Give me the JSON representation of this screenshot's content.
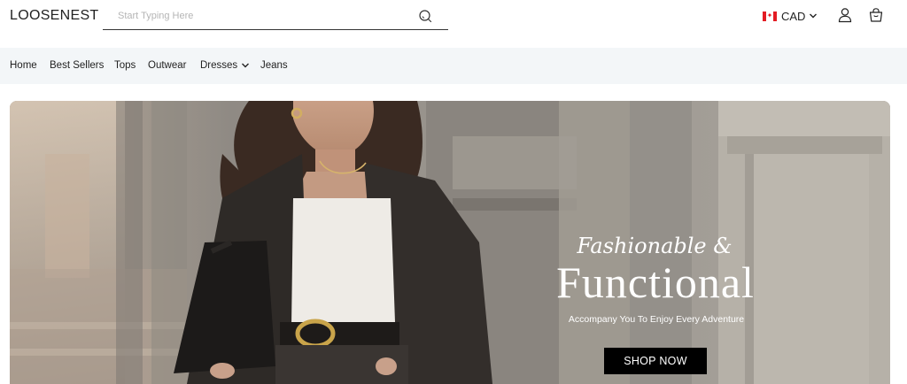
{
  "header": {
    "logo": "LOOSENEST",
    "search": {
      "placeholder": "Start Typing Here",
      "value": ""
    },
    "currency": {
      "code": "CAD",
      "flag": "canada-flag"
    },
    "icons": [
      "search-icon",
      "chevron-down-icon",
      "user-icon",
      "shopping-bag-icon"
    ]
  },
  "nav": {
    "items": [
      {
        "label": "Home"
      },
      {
        "label": "Best Sellers"
      },
      {
        "label": "Tops"
      },
      {
        "label": "Outwear"
      },
      {
        "label": "Dresses",
        "has_dropdown": true
      },
      {
        "label": "Jeans"
      }
    ]
  },
  "hero": {
    "kicker": "Fashionable &",
    "title": "Functional",
    "subtitle": "Accompany You To Enjoy Every Adventure",
    "cta": "SHOP NOW"
  },
  "colors": {
    "nav_bg": "#f3f6f8",
    "cta_bg": "#000000",
    "flag_red": "#e31b23"
  }
}
